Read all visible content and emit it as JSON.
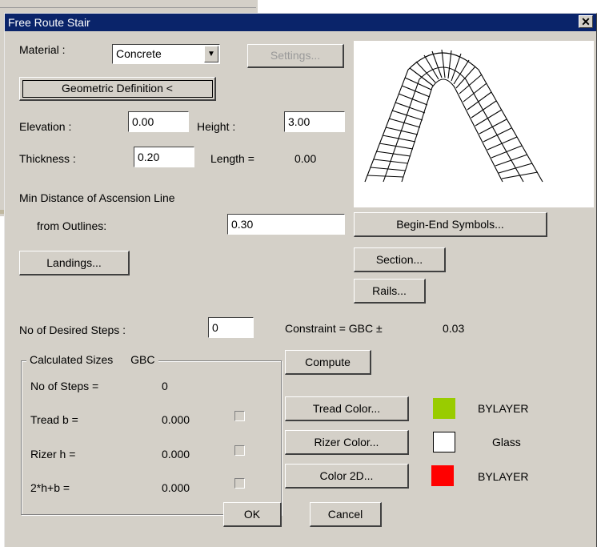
{
  "dialog": {
    "title": "Free Route Stair",
    "close": "✕"
  },
  "material": {
    "label": "Material :",
    "value": "Concrete",
    "settings_label": "Settings..."
  },
  "geometric_button": "Geometric Definition <",
  "elevation": {
    "label": "Elevation :",
    "value": "0.00"
  },
  "height": {
    "label": "Height :",
    "value": "3.00"
  },
  "thickness": {
    "label": "Thickness :",
    "value": "0.20"
  },
  "length": {
    "label": "Length =",
    "value": "0.00"
  },
  "min_distance": {
    "label_line1": "Min Distance of Ascension Line",
    "label_line2": "from Outlines:",
    "value": "0.30"
  },
  "buttons": {
    "begin_end": "Begin-End Symbols...",
    "landings": "Landings...",
    "section": "Section...",
    "rails": "Rails...",
    "compute": "Compute",
    "tread_color": "Tread Color...",
    "rizer_color": "Rizer Color...",
    "color2d": "Color 2D...",
    "ok": "OK",
    "cancel": "Cancel"
  },
  "steps": {
    "label": "No of Desired Steps :",
    "value": "0",
    "constraint_label": "Constraint = GBC ±",
    "constraint_value": "0.03"
  },
  "calculated": {
    "title": "Calculated Sizes",
    "gbc": "GBC",
    "no_steps_label": "No of Steps =",
    "no_steps_value": "0",
    "tread_label": "Tread b =",
    "tread_value": "0.000",
    "rizer_label": "Rizer h =",
    "rizer_value": "0.000",
    "formula_label": "2*h+b =",
    "formula_value": "0.000"
  },
  "colors": {
    "tread": {
      "swatch": "#99cc00",
      "text": "BYLAYER"
    },
    "rizer": {
      "swatch": "#ffffff",
      "text": "Glass"
    },
    "color2d": {
      "swatch": "#ff0000",
      "text": "BYLAYER"
    }
  }
}
